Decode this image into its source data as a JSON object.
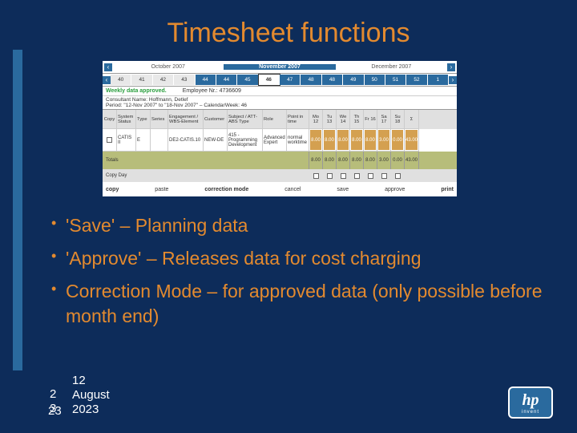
{
  "title": "Timesheet functions",
  "timesheet": {
    "months": {
      "prev": "October 2007",
      "current": "November 2007",
      "next": "December 2007"
    },
    "weeks_left": [
      "40",
      "41",
      "42",
      "43",
      "44"
    ],
    "weeks_mid": [
      "44",
      "45",
      "46",
      "47",
      "48"
    ],
    "weeks_selected": "46",
    "weeks_right": [
      "48",
      "49",
      "50",
      "51",
      "52",
      "1"
    ],
    "status": "Weekly data approved.",
    "employee_label": "Employee Nr.: 4736609",
    "period": "Consultant Name: Hoffmann, Detlef",
    "period2": "Period: \"12-Nov 2007\" to \"18-Nov 2007\" – CalendarWeek: 46",
    "headers": {
      "copy": "Copy",
      "system": "System\nStatus",
      "type": "Type",
      "series": "Series",
      "engagement": "Engagement / WBS-Element",
      "customer": "Customer",
      "subject": "Subject / ATT-ABS Type",
      "role": "Role",
      "pointintime": "Point in time",
      "mo": "Mo 12",
      "tu": "Tu 13",
      "we": "We 14",
      "th": "Th 15",
      "fr": "Fr 16",
      "sa": "Sa 17",
      "su": "Su 18",
      "sum": "Σ"
    },
    "row": {
      "system": "CATIS II",
      "type": "E",
      "series": "",
      "engagement": "DE2-CATIS.10",
      "customer": "NEW-DE",
      "subject": "415 - Programming Development",
      "role": "Advanced Expert",
      "pit": "normal worktime",
      "mo": "8.00",
      "tu": "8.00",
      "we": "8.00",
      "th": "8.00",
      "fr": "8.00",
      "sa": "3.00",
      "su": "0.00",
      "sum": "43.00"
    },
    "totals": {
      "label": "Totals",
      "mo": "8.00",
      "tu": "8.00",
      "we": "8.00",
      "th": "8.00",
      "fr": "8.00",
      "sa": "3.00",
      "su": "0.00",
      "sum": "43.00"
    },
    "copyday": "Copy Day",
    "actions": {
      "copy": "copy",
      "paste": "paste",
      "correction": "correction mode",
      "cancel": "cancel",
      "save": "save",
      "approve": "approve",
      "print": "print"
    }
  },
  "bullets": [
    "'Save' – Planning data",
    "'Approve' – Releases data for cost charging",
    "Correction Mode – for approved data (only possible before month end)"
  ],
  "footer": {
    "slide_num": "23",
    "date_line1": "12",
    "date_line2": "August",
    "date_line3": "2023"
  },
  "logo": {
    "text": "hp",
    "sub": "invent"
  }
}
